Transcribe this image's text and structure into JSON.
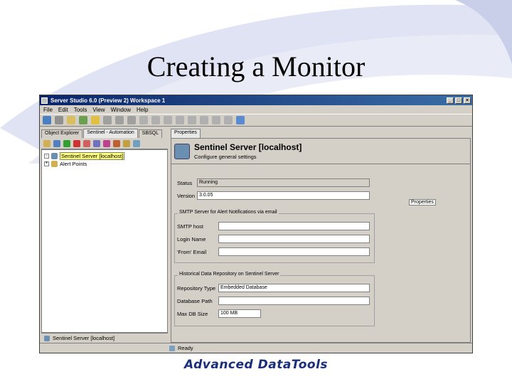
{
  "slide": {
    "title": "Creating a Monitor",
    "logo": "Advanced DataTools"
  },
  "window": {
    "title": "Server Studio 6.0 (Preview 2)   Workspace 1",
    "minimize": "_",
    "maximize": "□",
    "close": "×"
  },
  "menu": [
    "File",
    "Edit",
    "Tools",
    "View",
    "Window",
    "Help"
  ],
  "left_pane": {
    "tabs": [
      "Object Explorer",
      "Sentinel - Automation",
      "SBSQL"
    ],
    "tree": [
      {
        "label": "Sentinel Server [localhost]",
        "selected": true
      },
      {
        "label": "Alert Points",
        "selected": false
      }
    ],
    "status": "Sentinel Server [localhost]"
  },
  "right_pane": {
    "tab": "Properties",
    "header_title": "Sentinel Server [localhost]",
    "header_subtitle": "Configure general settings",
    "properties_button": "Properties",
    "general": {
      "status_label": "Status",
      "status_value": "Running",
      "version_label": "Version",
      "version_value": "3.0.05"
    },
    "smtp_group": {
      "legend": "SMTP Server for Alert Notifications via email",
      "smtp_host_label": "SMTP host",
      "smtp_host_value": "",
      "login_label": "Login Name",
      "login_value": "",
      "from_label": "'From' Email",
      "from_value": ""
    },
    "repo_group": {
      "legend": "Historical Data Repository on Sentinel Server",
      "type_label": "Repository Type",
      "type_value": "Embedded Database",
      "path_label": "Database Path",
      "path_value": "",
      "size_label": "Max DB Size",
      "size_value": "100 MB"
    }
  },
  "status_bar": {
    "text": "Ready"
  }
}
